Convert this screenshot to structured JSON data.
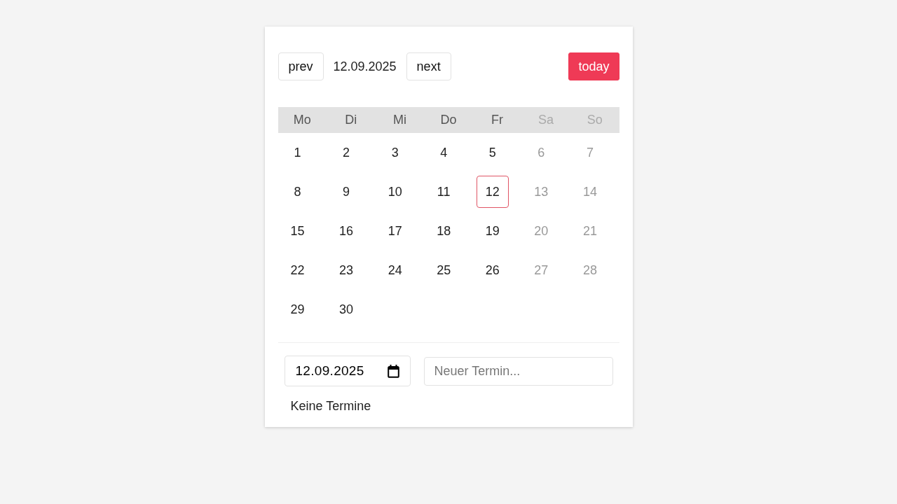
{
  "toolbar": {
    "prev_button": "prev",
    "current_date": "12.09.2025",
    "next_button": "next",
    "today_button": "today"
  },
  "calendar": {
    "weekdays": [
      {
        "label": "Mo",
        "weekend": false
      },
      {
        "label": "Di",
        "weekend": false
      },
      {
        "label": "Mi",
        "weekend": false
      },
      {
        "label": "Do",
        "weekend": false
      },
      {
        "label": "Fr",
        "weekend": false
      },
      {
        "label": "Sa",
        "weekend": true
      },
      {
        "label": "So",
        "weekend": true
      }
    ],
    "weeks": [
      {
        "days": [
          {
            "label": "1",
            "weekend": false,
            "selected": false
          },
          {
            "label": "2",
            "weekend": false,
            "selected": false
          },
          {
            "label": "3",
            "weekend": false,
            "selected": false
          },
          {
            "label": "4",
            "weekend": false,
            "selected": false
          },
          {
            "label": "5",
            "weekend": false,
            "selected": false
          },
          {
            "label": "6",
            "weekend": true,
            "selected": false
          },
          {
            "label": "7",
            "weekend": true,
            "selected": false
          }
        ]
      },
      {
        "days": [
          {
            "label": "8",
            "weekend": false,
            "selected": false
          },
          {
            "label": "9",
            "weekend": false,
            "selected": false
          },
          {
            "label": "10",
            "weekend": false,
            "selected": false
          },
          {
            "label": "11",
            "weekend": false,
            "selected": false
          },
          {
            "label": "12",
            "weekend": false,
            "selected": true
          },
          {
            "label": "13",
            "weekend": true,
            "selected": false
          },
          {
            "label": "14",
            "weekend": true,
            "selected": false
          }
        ]
      },
      {
        "days": [
          {
            "label": "15",
            "weekend": false,
            "selected": false
          },
          {
            "label": "16",
            "weekend": false,
            "selected": false
          },
          {
            "label": "17",
            "weekend": false,
            "selected": false
          },
          {
            "label": "18",
            "weekend": false,
            "selected": false
          },
          {
            "label": "19",
            "weekend": false,
            "selected": false
          },
          {
            "label": "20",
            "weekend": true,
            "selected": false
          },
          {
            "label": "21",
            "weekend": true,
            "selected": false
          }
        ]
      },
      {
        "days": [
          {
            "label": "22",
            "weekend": false,
            "selected": false
          },
          {
            "label": "23",
            "weekend": false,
            "selected": false
          },
          {
            "label": "24",
            "weekend": false,
            "selected": false
          },
          {
            "label": "25",
            "weekend": false,
            "selected": false
          },
          {
            "label": "26",
            "weekend": false,
            "selected": false
          },
          {
            "label": "27",
            "weekend": true,
            "selected": false
          },
          {
            "label": "28",
            "weekend": true,
            "selected": false
          }
        ]
      },
      {
        "days": [
          {
            "label": "29",
            "weekend": false,
            "selected": false
          },
          {
            "label": "30",
            "weekend": false,
            "selected": false
          }
        ]
      }
    ]
  },
  "entry_form": {
    "date_field": {
      "value": "12.09.2025"
    },
    "title_field": {
      "placeholder": "Neuer Termin..."
    }
  },
  "events_message": "Keine Termine"
}
